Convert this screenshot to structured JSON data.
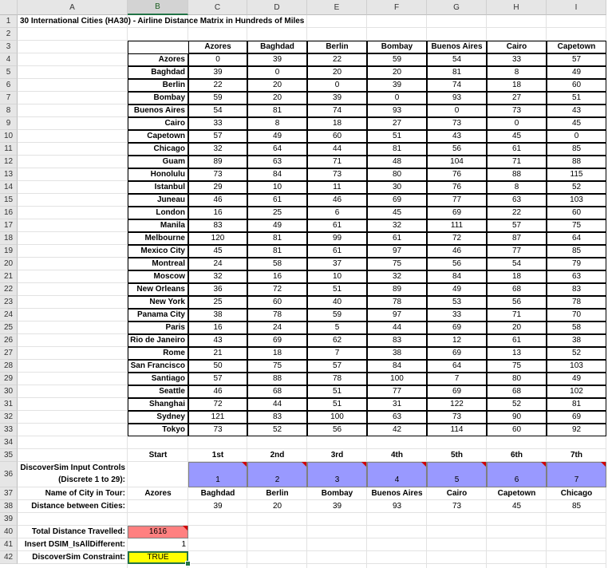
{
  "sheet": {
    "column_headers": [
      "A",
      "B",
      "C",
      "D",
      "E",
      "F",
      "G",
      "H",
      "I"
    ],
    "row_numbers": [
      "1",
      "2",
      "3",
      "4",
      "5",
      "6",
      "7",
      "8",
      "9",
      "10",
      "11",
      "12",
      "13",
      "14",
      "15",
      "16",
      "17",
      "18",
      "19",
      "20",
      "21",
      "22",
      "23",
      "24",
      "25",
      "26",
      "27",
      "28",
      "29",
      "30",
      "31",
      "32",
      "33",
      "34",
      "35",
      "36",
      "37",
      "38",
      "39",
      "40",
      "41",
      "42"
    ],
    "selected_column": "B",
    "title": "30 International Cities (HA30) - Airline Distance Matrix in Hundreds of Miles",
    "matrix": {
      "col_cities": [
        "Azores",
        "Baghdad",
        "Berlin",
        "Bombay",
        "Buenos Aires",
        "Cairo",
        "Capetown"
      ],
      "rows": [
        {
          "city": "Azores",
          "values": [
            "0",
            "39",
            "22",
            "59",
            "54",
            "33",
            "57"
          ]
        },
        {
          "city": "Baghdad",
          "values": [
            "39",
            "0",
            "20",
            "20",
            "81",
            "8",
            "49"
          ]
        },
        {
          "city": "Berlin",
          "values": [
            "22",
            "20",
            "0",
            "39",
            "74",
            "18",
            "60"
          ]
        },
        {
          "city": "Bombay",
          "values": [
            "59",
            "20",
            "39",
            "0",
            "93",
            "27",
            "51"
          ]
        },
        {
          "city": "Buenos Aires",
          "values": [
            "54",
            "81",
            "74",
            "93",
            "0",
            "73",
            "43"
          ]
        },
        {
          "city": "Cairo",
          "values": [
            "33",
            "8",
            "18",
            "27",
            "73",
            "0",
            "45"
          ]
        },
        {
          "city": "Capetown",
          "values": [
            "57",
            "49",
            "60",
            "51",
            "43",
            "45",
            "0"
          ]
        },
        {
          "city": "Chicago",
          "values": [
            "32",
            "64",
            "44",
            "81",
            "56",
            "61",
            "85"
          ]
        },
        {
          "city": "Guam",
          "values": [
            "89",
            "63",
            "71",
            "48",
            "104",
            "71",
            "88"
          ]
        },
        {
          "city": "Honolulu",
          "values": [
            "73",
            "84",
            "73",
            "80",
            "76",
            "88",
            "115"
          ]
        },
        {
          "city": "Istanbul",
          "values": [
            "29",
            "10",
            "11",
            "30",
            "76",
            "8",
            "52"
          ]
        },
        {
          "city": "Juneau",
          "values": [
            "46",
            "61",
            "46",
            "69",
            "77",
            "63",
            "103"
          ]
        },
        {
          "city": "London",
          "values": [
            "16",
            "25",
            "6",
            "45",
            "69",
            "22",
            "60"
          ]
        },
        {
          "city": "Manila",
          "values": [
            "83",
            "49",
            "61",
            "32",
            "111",
            "57",
            "75"
          ]
        },
        {
          "city": "Melbourne",
          "values": [
            "120",
            "81",
            "99",
            "61",
            "72",
            "87",
            "64"
          ]
        },
        {
          "city": "Mexico City",
          "values": [
            "45",
            "81",
            "61",
            "97",
            "46",
            "77",
            "85"
          ]
        },
        {
          "city": "Montreal",
          "values": [
            "24",
            "58",
            "37",
            "75",
            "56",
            "54",
            "79"
          ]
        },
        {
          "city": "Moscow",
          "values": [
            "32",
            "16",
            "10",
            "32",
            "84",
            "18",
            "63"
          ]
        },
        {
          "city": "New Orleans",
          "values": [
            "36",
            "72",
            "51",
            "89",
            "49",
            "68",
            "83"
          ]
        },
        {
          "city": "New York",
          "values": [
            "25",
            "60",
            "40",
            "78",
            "53",
            "56",
            "78"
          ]
        },
        {
          "city": "Panama City",
          "values": [
            "38",
            "78",
            "59",
            "97",
            "33",
            "71",
            "70"
          ]
        },
        {
          "city": "Paris",
          "values": [
            "16",
            "24",
            "5",
            "44",
            "69",
            "20",
            "58"
          ]
        },
        {
          "city": "Rio de Janeiro",
          "values": [
            "43",
            "69",
            "62",
            "83",
            "12",
            "61",
            "38"
          ]
        },
        {
          "city": "Rome",
          "values": [
            "21",
            "18",
            "7",
            "38",
            "69",
            "13",
            "52"
          ]
        },
        {
          "city": "San Francisco",
          "values": [
            "50",
            "75",
            "57",
            "84",
            "64",
            "75",
            "103"
          ]
        },
        {
          "city": "Santiago",
          "values": [
            "57",
            "88",
            "78",
            "100",
            "7",
            "80",
            "49"
          ]
        },
        {
          "city": "Seattle",
          "values": [
            "46",
            "68",
            "51",
            "77",
            "69",
            "68",
            "102"
          ]
        },
        {
          "city": "Shanghai",
          "values": [
            "72",
            "44",
            "51",
            "31",
            "122",
            "52",
            "81"
          ]
        },
        {
          "city": "Sydney",
          "values": [
            "121",
            "83",
            "100",
            "63",
            "73",
            "90",
            "69"
          ]
        },
        {
          "city": "Tokyo",
          "values": [
            "73",
            "52",
            "56",
            "42",
            "114",
            "60",
            "92"
          ]
        }
      ]
    },
    "tour": {
      "start_label": "Start",
      "stop_labels": [
        "1st",
        "2nd",
        "3rd",
        "4th",
        "5th",
        "6th",
        "7th"
      ],
      "inputs_label_line1": "DiscoverSim Input Controls",
      "inputs_label_line2": "(Discrete 1 to 29):",
      "inputs": [
        "1",
        "2",
        "3",
        "4",
        "5",
        "6",
        "7"
      ],
      "city_label": "Name of City in Tour:",
      "start_city": "Azores",
      "cities": [
        "Baghdad",
        "Berlin",
        "Bombay",
        "Buenos Aires",
        "Cairo",
        "Capetown",
        "Chicago"
      ],
      "distance_label": "Distance between Cities:",
      "distances": [
        "39",
        "20",
        "39",
        "93",
        "73",
        "45",
        "85"
      ]
    },
    "summary": {
      "total_label": "Total Distance Travelled:",
      "total_value": "1616",
      "alldiff_label": "Insert DSIM_IsAllDifferent:",
      "alldiff_value": "1",
      "constraint_label": "DiscoverSim Constraint:",
      "constraint_value": "TRUE"
    },
    "colors": {
      "input_fill": "#9999ff",
      "total_fill": "#ff8080",
      "constraint_fill": "#ffff00",
      "comment_marker": "#d00000",
      "selection": "#217346"
    }
  }
}
